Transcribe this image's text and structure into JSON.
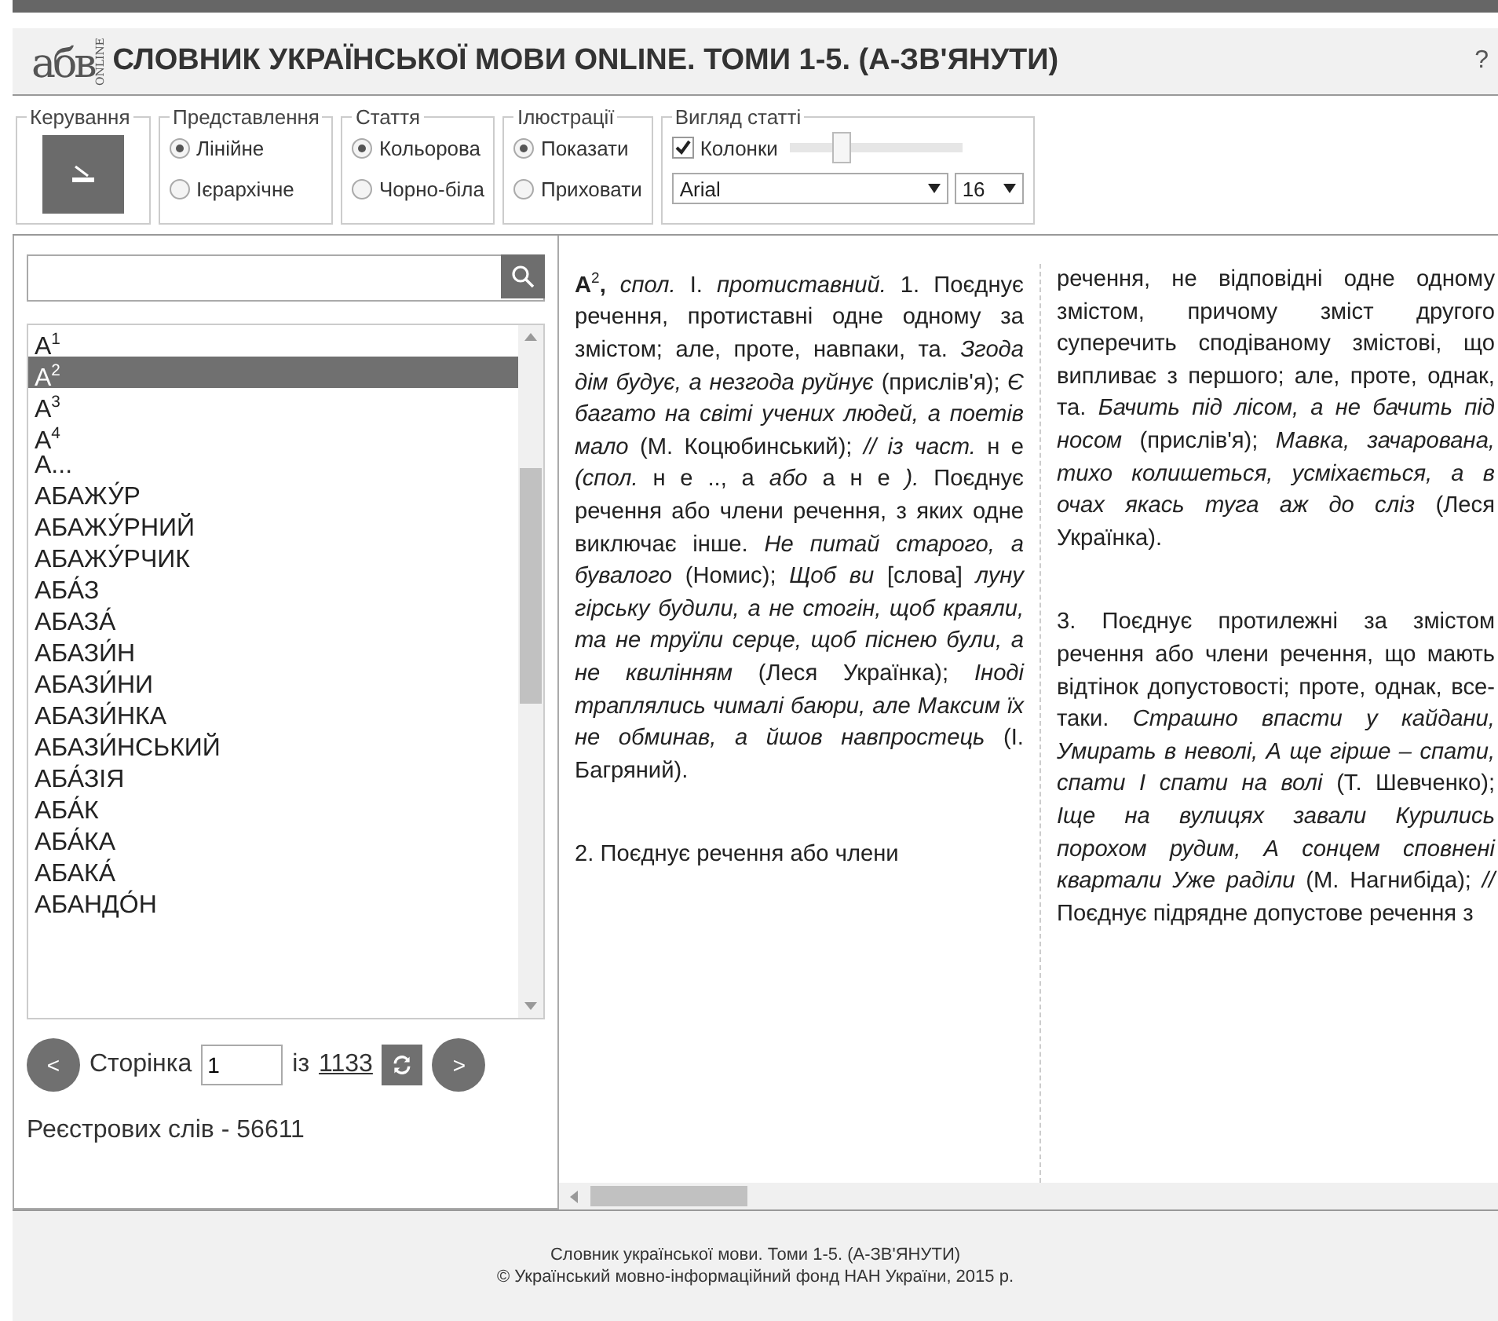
{
  "header": {
    "logo": {
      "letters": "абв",
      "tag": "ONLINE"
    },
    "title": "СЛОВНИК УКРАЇНСЬКОЇ МОВИ ONLINE. ТОМИ 1-5. (А-ЗВ'ЯНУТИ)",
    "help": "?"
  },
  "toolbar": {
    "groups": [
      {
        "legend": "Керування",
        "kind": "button"
      },
      {
        "legend": "Представлення",
        "kind": "radios",
        "options": [
          {
            "label": "Лінійне",
            "selected": true
          },
          {
            "label": "Ієрархічне",
            "selected": false
          }
        ]
      },
      {
        "legend": "Стаття",
        "kind": "radios",
        "options": [
          {
            "label": "Кольорова",
            "selected": true
          },
          {
            "label": "Чорно-біла",
            "selected": false
          }
        ]
      },
      {
        "legend": "Ілюстрації",
        "kind": "radios",
        "options": [
          {
            "label": "Показати",
            "selected": true
          },
          {
            "label": "Приховати",
            "selected": false
          }
        ]
      },
      {
        "legend": "Вигляд статті",
        "kind": "view",
        "checkbox": {
          "label": "Колонки",
          "checked": true
        },
        "slider": {
          "level": 0.3
        },
        "font": "Arial",
        "size": "16"
      }
    ]
  },
  "sidebar": {
    "items": [
      {
        "label": "А$^{1}$",
        "selected": false
      },
      {
        "label": "А$^{2}$",
        "selected": true
      },
      {
        "label": "А$^{3}$",
        "selected": false
      },
      {
        "label": "А$^{4}$",
        "selected": false
      },
      {
        "label": "А...",
        "selected": false
      },
      {
        "label": "АБАЖУ́Р",
        "selected": false
      },
      {
        "label": "АБАЖУ́РНИЙ",
        "selected": false
      },
      {
        "label": "АБАЖУ́РЧИК",
        "selected": false
      },
      {
        "label": "АБА́З",
        "selected": false
      },
      {
        "label": "АБАЗА́",
        "selected": false
      },
      {
        "label": "АБАЗИ́Н",
        "selected": false
      },
      {
        "label": "АБАЗИ́НИ",
        "selected": false
      },
      {
        "label": "АБАЗИ́НКА",
        "selected": false
      },
      {
        "label": "АБАЗИ́НСЬКИЙ",
        "selected": false
      },
      {
        "label": "АБА́ЗІЯ",
        "selected": false
      },
      {
        "label": "АБА́К",
        "selected": false
      },
      {
        "label": "АБА́КА",
        "selected": false
      },
      {
        "label": "АБАКА́",
        "selected": false
      },
      {
        "label": "АБАНДО́Н",
        "selected": false
      }
    ],
    "pager": {
      "prev": "<",
      "label": "Сторінка",
      "value": "1",
      "of": "із",
      "total": "1133",
      "next": ">"
    },
    "count": "Реєстрових слів - 56611"
  },
  "article": {
    "columns": [
      [
        "**А**$^{2}$**,** *спол.* I. *протиставний.* 1. Поєднує речення, протиставні одне одному за змістом; але, проте, навпаки, та. *Згода дім будує, а незгода руйнує* (прислів'я); *Є багато на світі учених людей, а поетів мало* (М. Коцюбинський); *// із част.* н е *(спол.* н е .., а *або* а н е *).* Поєднує речення або члени речення, з яких одне виключає інше. *Не питай старого, а бувалого* (Номис); *Щоб ви* [слова] *луну гірську будили, а не стогін, щоб краяли, та не труїли серце, щоб піснею були, а не квилінням* (Леся Українка); *Іноді траплялись чималі баюри, але Максим їх не обминав, а йшов навпростець* (І. Багряний).",
        "2. Поєднує речення або члени"
      ],
      [
        "речення, не відповідні одне одному змістом, причому зміст другого суперечить сподіваному змістові, що випливає з першого; але, проте, однак, та. *Бачить під лісом, а не бачить під носом* (прислів'я); *Мавка, зачарована, тихо колишеться, усміхається, а в очах якась туга аж до сліз* (Леся Українка).",
        "3. Поєднує протилежні за змістом речення або члени речення, що мають відтінок допустовості; проте, однак, все-таки. *Страшно впасти у кайдани, Умирать в неволі, А ще гірше – спати, спати І спати на волі* (Т. Шевченко); *Іще на вулицях завали Курились порохом рудим, А сонцем сповнені квартали Уже раділи* (М. Нагнибіда); *//* Поєднує підрядне допустове речення з"
      ]
    ]
  },
  "footer": {
    "lines": [
      "Словник української мови. Томи 1-5. (А-ЗВ'ЯНУТИ)",
      "© Український мовно-інформаційний фонд НАН України, 2015 р."
    ]
  }
}
